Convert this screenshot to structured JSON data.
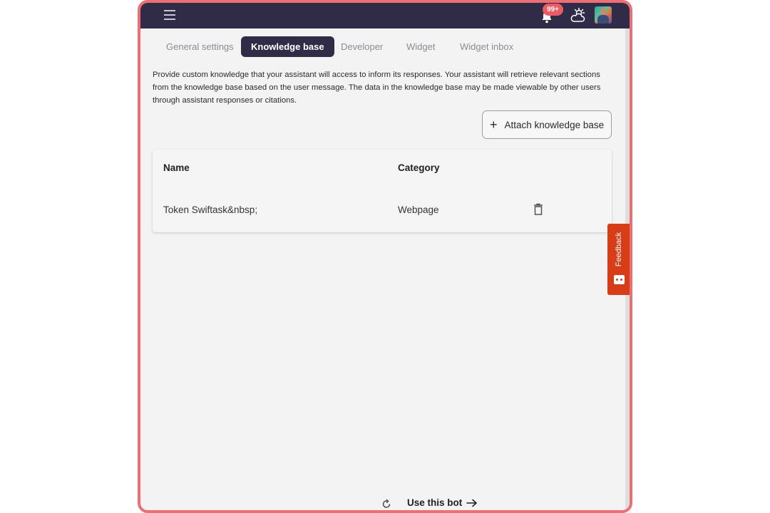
{
  "header": {
    "notification_badge": "99+",
    "menu_icon": "hamburger-icon",
    "bell_icon": "bell-icon",
    "weather_icon": "weather-icon"
  },
  "tabs": [
    {
      "label": "General settings"
    },
    {
      "label": "Knowledge base",
      "active": true
    },
    {
      "label": "Developer"
    },
    {
      "label": "Widget"
    },
    {
      "label": "Widget inbox"
    }
  ],
  "main": {
    "description": "Provide custom knowledge that your assistant will access to inform its responses. Your assistant will retrieve relevant sections from the knowledge base based on the user message. The data in the knowledge base may be made viewable by other users through assistant responses or citations.",
    "attach_button": "Attach knowledge base",
    "table": {
      "columns": [
        "Name",
        "Category"
      ],
      "rows": [
        {
          "name": "Token Swiftask&nbsp;",
          "category": "Webpage"
        }
      ]
    }
  },
  "feedback": {
    "label": "Feedback"
  },
  "footer": {
    "use_bot": "Use this bot"
  },
  "colors": {
    "topbar": "#302c47",
    "frame_border": "#ec7073",
    "feedback": "#d73d17",
    "badge": "#ee5a62"
  }
}
